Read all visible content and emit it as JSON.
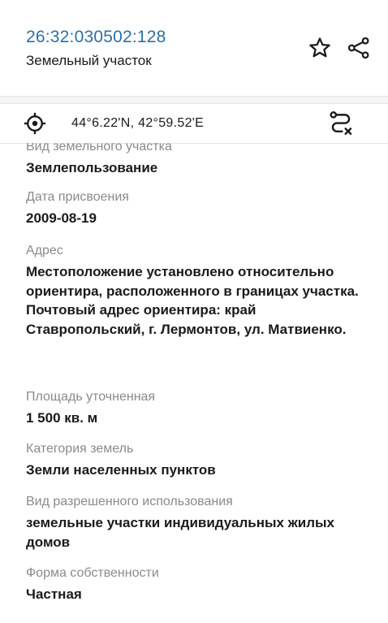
{
  "header": {
    "cadastral_number": "26:32:030502:128",
    "object_type": "Земельный участок"
  },
  "icons": {
    "favorite": "star-icon",
    "share": "share-icon",
    "locate": "crosshair-icon",
    "route": "route-icon"
  },
  "coords": {
    "text": "44°6.22'N, 42°59.52'E"
  },
  "fields": [
    {
      "label": "Вид земельного участка",
      "value": "Землепользование"
    },
    {
      "label": "Дата присвоения",
      "value": "2009-08-19"
    },
    {
      "label": "Адрес",
      "value": "Местоположение установлено относительно ориентира, расположенного в границах участка. Почтовый адрес ориентира: край Ставропольский, г. Лермонтов, ул. Матвиенко."
    },
    {
      "label": "Площадь уточненная",
      "value": "1 500 кв. м"
    },
    {
      "label": "Категория земель",
      "value": "Земли населенных пунктов"
    },
    {
      "label": "Вид разрешенного использования",
      "value": "земельные участки индивидуальных жилых домов"
    },
    {
      "label": "Форма собственности",
      "value": "Частная"
    }
  ],
  "colors": {
    "accent": "#2d6fa3",
    "label": "#8a8a8a",
    "text": "#1a1a1a"
  }
}
